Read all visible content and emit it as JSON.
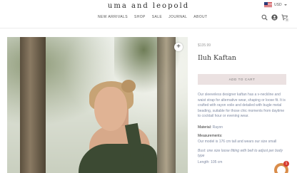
{
  "brand": {
    "logo": "uma and leopold"
  },
  "nav": {
    "items": [
      "NEW ARRIVALS",
      "SHOP",
      "SALE",
      "JOURNAL",
      "ABOUT"
    ]
  },
  "currency": {
    "label": "USD"
  },
  "cart": {
    "count": "0"
  },
  "icons": [
    "search-icon",
    "account-icon",
    "cart-icon",
    "zoom-plus-icon",
    "chat-icon"
  ],
  "product": {
    "price": "$135.99",
    "title": "Iluh Kaftan",
    "add_to_cart": "ADD TO CART",
    "description": "Our sleeveless designer kaftan has a v-neckline and waist strap for alternative wear, shaping or loose fit. It is crafted with rayon voile and detailed with bugle metal beading, suitable for those chic moments from daytime to cocktail hour or evening wear.",
    "material_label": "Material:",
    "material_value": "Rayon",
    "measurements_label": "Measurements:",
    "measurements_value": "Our model is 176 cm tall and wears our size small",
    "bust_text": "Bust: one size loose fitting with belt to adjust per body type",
    "length_text": "Length: 105 cm"
  },
  "chat": {
    "badge": "1"
  },
  "colors": {
    "accent_button": "#ebe1e1",
    "body_text": "#7f8aa2",
    "chat": "#d98c4a"
  }
}
